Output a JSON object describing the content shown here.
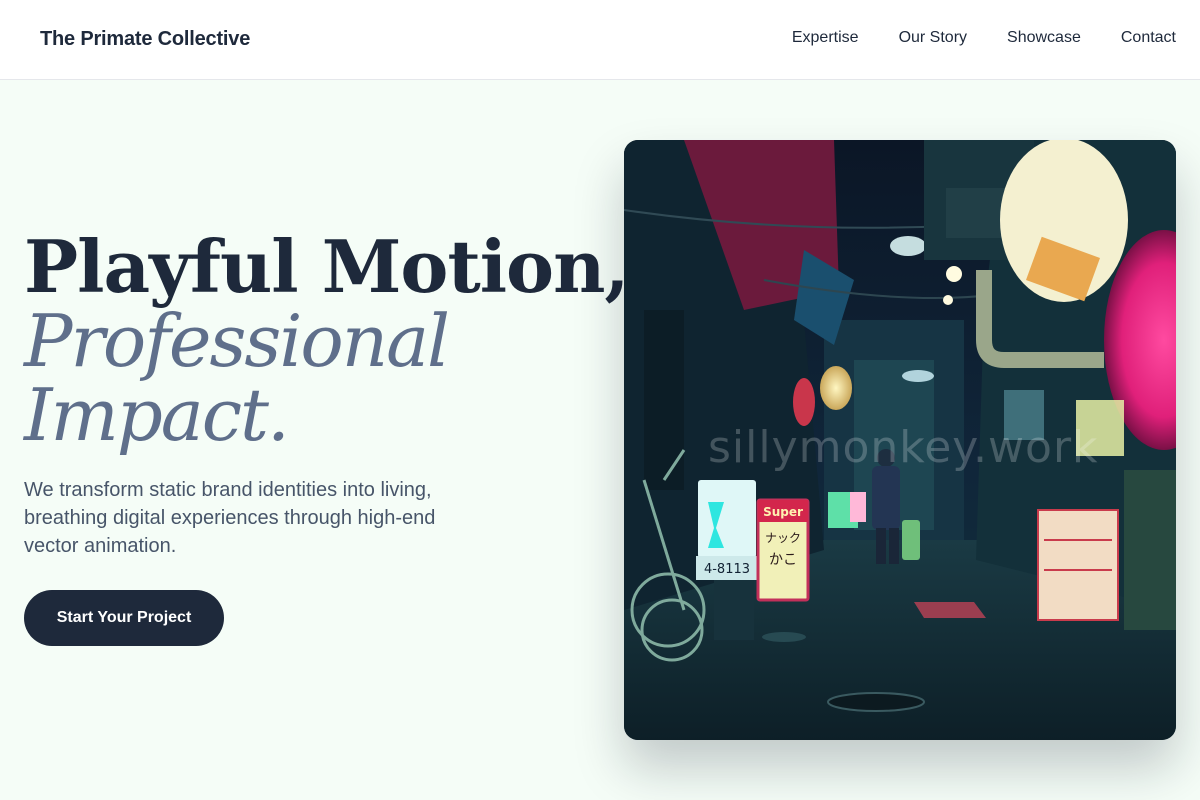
{
  "brand": {
    "name": "The Primate Collective"
  },
  "nav": {
    "links": [
      "Expertise",
      "Our Story",
      "Showcase",
      "Contact"
    ]
  },
  "hero": {
    "title_line1": "Playful Motion,",
    "title_line2": "Professional",
    "title_line3": "Impact.",
    "subtitle": "We transform static brand identities into living, breathing digital experiences through high-end vector animation.",
    "cta_label": "Start Your Project"
  },
  "image": {
    "watermark": "sillymonkey.work",
    "signs": [
      "Super",
      "ナック",
      "かこ",
      "4-8113"
    ]
  },
  "colors": {
    "background": "#f5fdf7",
    "primary": "#1e293b",
    "accent_text": "#5f6f8b",
    "neon_pink": "#ff2d8a",
    "neon_cyan": "#2ee6e0"
  }
}
